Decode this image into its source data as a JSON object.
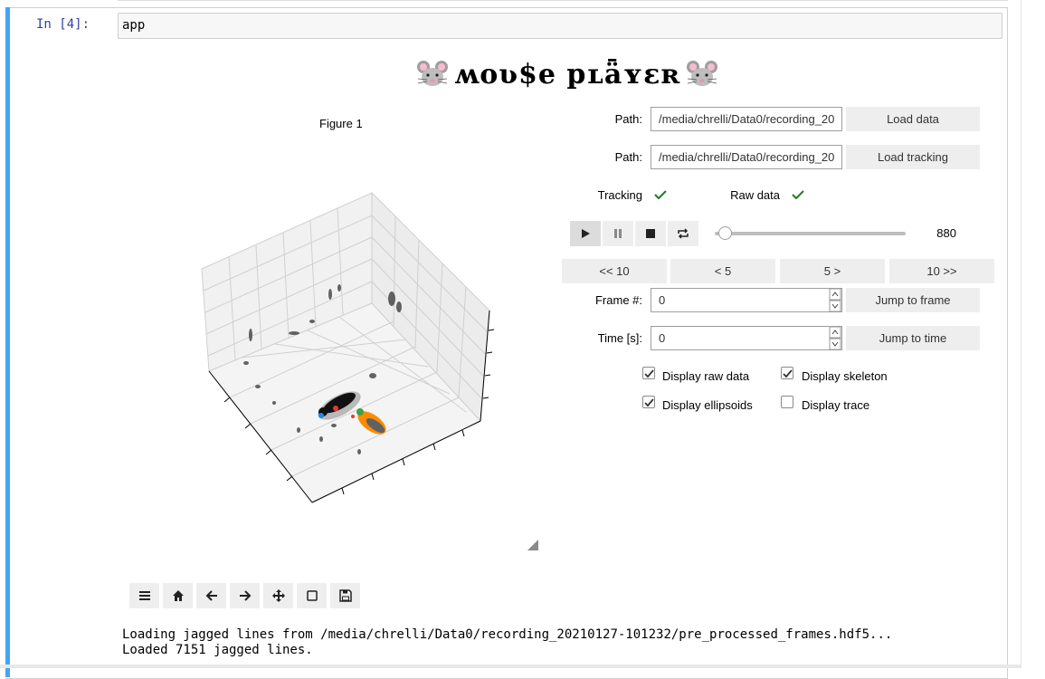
{
  "cell": {
    "prompt": "In [4]:",
    "code": "app"
  },
  "app_title": "ʍoʋ$e pʟǟʏɛʀ",
  "figure": {
    "label": "Figure 1"
  },
  "loaders": [
    {
      "label": "Path:",
      "value": "/media/chrelli/Data0/recording_20",
      "button": "Load data"
    },
    {
      "label": "Path:",
      "value": "/media/chrelli/Data0/recording_20",
      "button": "Load tracking"
    }
  ],
  "status": {
    "tracking_label": "Tracking",
    "rawdata_label": "Raw data",
    "tracking_ok": true,
    "rawdata_ok": true
  },
  "player": {
    "frame_value": "880",
    "slider_fraction": 0.07
  },
  "step_buttons": [
    "<< 10",
    "< 5",
    "5 >",
    "10 >>"
  ],
  "frame": {
    "label": "Frame #:",
    "value": "0",
    "button": "Jump to frame"
  },
  "time": {
    "label": "Time [s]:",
    "value": "0",
    "button": "Jump to time"
  },
  "options": [
    {
      "label": "Display raw data",
      "checked": true
    },
    {
      "label": "Display skeleton",
      "checked": true
    },
    {
      "label": "Display ellipsoids",
      "checked": true
    },
    {
      "label": "Display trace",
      "checked": false
    }
  ],
  "toolbar_icons": [
    "menu-icon",
    "home-icon",
    "back-arrow-icon",
    "forward-arrow-icon",
    "pan-icon",
    "zoom-rect-icon",
    "save-icon"
  ],
  "output": {
    "line1": "Loading jagged lines from /media/chrelli/Data0/recording_20210127-101232/pre_processed_frames.hdf5...",
    "line2": "Loaded 7151 jagged lines."
  },
  "colors": {
    "accent": "#42a5f5",
    "prompt": "#303f9f",
    "check": "#2e7d32"
  }
}
